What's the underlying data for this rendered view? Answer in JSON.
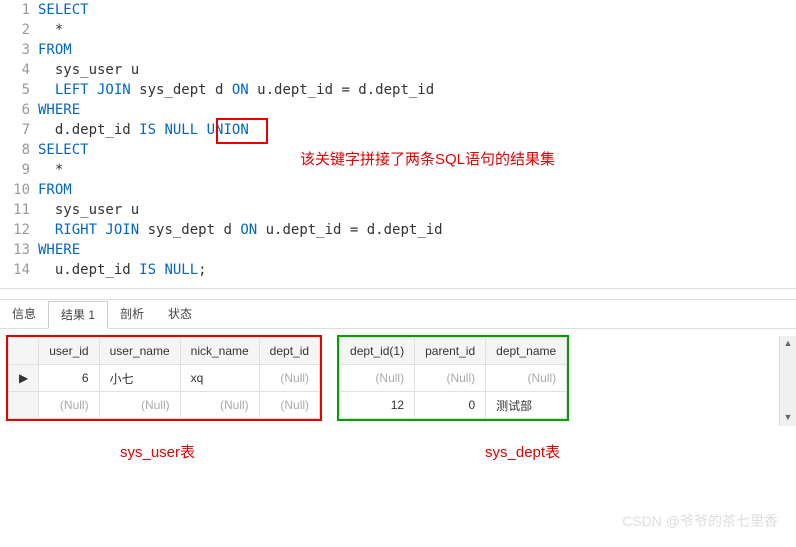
{
  "editor": {
    "lines": [
      {
        "n": 1,
        "tokens": [
          {
            "t": "SELECT",
            "c": "kw"
          }
        ]
      },
      {
        "n": 2,
        "tokens": [
          {
            "t": "  *",
            "c": ""
          }
        ]
      },
      {
        "n": 3,
        "tokens": [
          {
            "t": "FROM",
            "c": "kw"
          }
        ]
      },
      {
        "n": 4,
        "tokens": [
          {
            "t": "  sys_user u",
            "c": ""
          }
        ]
      },
      {
        "n": 5,
        "tokens": [
          {
            "t": "  ",
            "c": ""
          },
          {
            "t": "LEFT JOIN",
            "c": "kw"
          },
          {
            "t": " sys_dept d ",
            "c": ""
          },
          {
            "t": "ON",
            "c": "kw"
          },
          {
            "t": " u.dept_id = d.dept_id",
            "c": ""
          }
        ]
      },
      {
        "n": 6,
        "tokens": [
          {
            "t": "WHERE",
            "c": "kw"
          }
        ]
      },
      {
        "n": 7,
        "tokens": [
          {
            "t": "  d.dept_id ",
            "c": ""
          },
          {
            "t": "IS NULL",
            "c": "kw"
          },
          {
            "t": " ",
            "c": ""
          },
          {
            "t": "UNION",
            "c": "kw"
          }
        ]
      },
      {
        "n": 8,
        "tokens": [
          {
            "t": "SELECT",
            "c": "kw"
          }
        ]
      },
      {
        "n": 9,
        "tokens": [
          {
            "t": "  *",
            "c": ""
          }
        ]
      },
      {
        "n": 10,
        "tokens": [
          {
            "t": "FROM",
            "c": "kw"
          }
        ]
      },
      {
        "n": 11,
        "tokens": [
          {
            "t": "  sys_user u",
            "c": ""
          }
        ]
      },
      {
        "n": 12,
        "tokens": [
          {
            "t": "  ",
            "c": ""
          },
          {
            "t": "RIGHT JOIN",
            "c": "kw"
          },
          {
            "t": " sys_dept d ",
            "c": ""
          },
          {
            "t": "ON",
            "c": "kw"
          },
          {
            "t": " u.dept_id = d.dept_id",
            "c": ""
          }
        ]
      },
      {
        "n": 13,
        "tokens": [
          {
            "t": "WHERE",
            "c": "kw"
          }
        ]
      },
      {
        "n": 14,
        "tokens": [
          {
            "t": "  u.dept_id ",
            "c": ""
          },
          {
            "t": "IS NULL",
            "c": "kw"
          },
          {
            "t": ";",
            "c": ""
          }
        ]
      }
    ]
  },
  "tabs": {
    "items": [
      "信息",
      "结果 1",
      "剖析",
      "状态"
    ],
    "active": 1
  },
  "table_left": {
    "headers": [
      "user_id",
      "user_name",
      "nick_name",
      "dept_id"
    ],
    "rows": [
      [
        {
          "v": "6",
          "num": true
        },
        {
          "v": "小七"
        },
        {
          "v": "xq"
        },
        {
          "v": "(Null)",
          "null": true
        }
      ],
      [
        {
          "v": "(Null)",
          "null": true
        },
        {
          "v": "(Null)",
          "null": true
        },
        {
          "v": "(Null)",
          "null": true
        },
        {
          "v": "(Null)",
          "null": true
        }
      ]
    ]
  },
  "table_right": {
    "headers": [
      "dept_id(1)",
      "parent_id",
      "dept_name"
    ],
    "rows": [
      [
        {
          "v": "(Null)",
          "null": true
        },
        {
          "v": "(Null)",
          "null": true
        },
        {
          "v": "(Null)",
          "null": true
        }
      ],
      [
        {
          "v": "12",
          "num": true
        },
        {
          "v": "0",
          "num": true
        },
        {
          "v": "测试部"
        }
      ]
    ]
  },
  "labels": {
    "left": "sys_user表",
    "right": "sys_dept表"
  },
  "annotation": "该关键字拼接了两条SQL语句的结果集",
  "watermark": "CSDN @爷爷的茶七里香",
  "scroll_arrows": {
    "up": "▲",
    "down": "▼"
  }
}
